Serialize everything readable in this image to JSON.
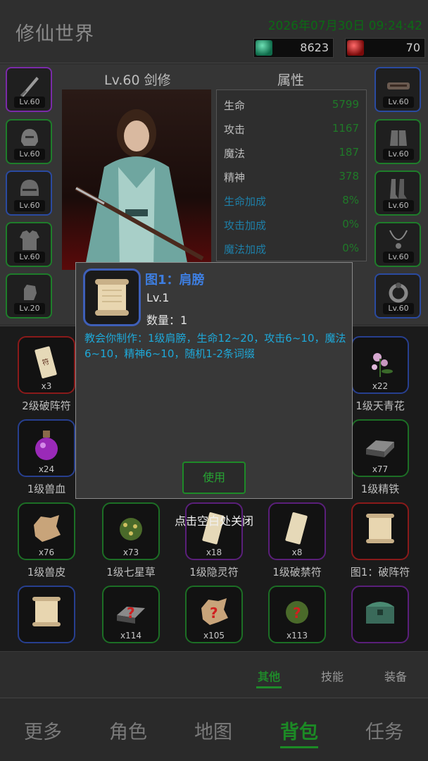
{
  "header": {
    "title": "修仙世界",
    "datetime": "2026年07月30日 09:24:42",
    "currency_green": "8623",
    "currency_red": "70"
  },
  "character": {
    "class_title": "Lv.60 剑修",
    "attr_title": "属性",
    "left_slots": [
      "Lv.60",
      "Lv.60",
      "Lv.60",
      "Lv.60",
      "Lv.20"
    ],
    "right_slots": [
      "Lv.60",
      "Lv.60",
      "Lv.60",
      "Lv.60",
      "Lv.60"
    ],
    "attributes": [
      {
        "k": "生命",
        "v": "5799"
      },
      {
        "k": "攻击",
        "v": "1167"
      },
      {
        "k": "魔法",
        "v": "187"
      },
      {
        "k": "精神",
        "v": "378"
      },
      {
        "k": "生命加成",
        "v": "8%"
      },
      {
        "k": "攻击加成",
        "v": "0%"
      },
      {
        "k": "魔法加成",
        "v": "0%"
      }
    ]
  },
  "inventory": {
    "items": [
      {
        "count": "x3",
        "name": "2级破阵符"
      },
      {
        "count": "x22",
        "name": "1级天青花"
      },
      {
        "count": "x24",
        "name": "1级兽血"
      },
      {
        "count": "x77",
        "name": "1级精铁"
      },
      {
        "count": "x76",
        "name": "1级兽皮"
      },
      {
        "count": "x73",
        "name": "1级七星草"
      },
      {
        "count": "x18",
        "name": "1级隐灵符"
      },
      {
        "count": "x8",
        "name": "1级破禁符"
      },
      {
        "count": "",
        "name": "图1：破阵符"
      },
      {
        "count": "",
        "name": ""
      },
      {
        "count": "x114",
        "name": ""
      },
      {
        "count": "x105",
        "name": ""
      },
      {
        "count": "x113",
        "name": ""
      },
      {
        "count": "",
        "name": ""
      }
    ]
  },
  "modal": {
    "item_name": "图1：肩膀",
    "level": "Lv.1",
    "quantity": "数量：1",
    "description": "教会你制作：1级肩膀，生命12~20，攻击6~10，魔法6~10，精神6~10，随机1-2条词缀",
    "use_label": "使用",
    "close_hint": "点击空白处关闭"
  },
  "subtabs": [
    "其他",
    "技能",
    "装备"
  ],
  "nav": [
    "更多",
    "角色",
    "地图",
    "背包",
    "任务"
  ],
  "colors": {
    "accent_green": "#1c8a25",
    "link_blue": "#3e7ee0",
    "desc_cyan": "#1ea8d8"
  }
}
